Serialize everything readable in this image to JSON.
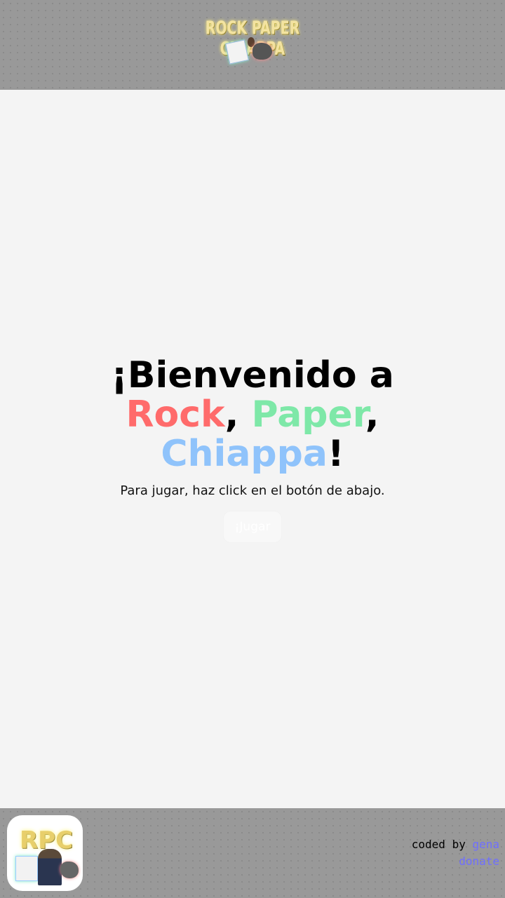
{
  "header": {
    "logo_text": "ROCK PAPER CHIAPPA"
  },
  "main": {
    "title_prefix": "¡Bienvenido a",
    "title_rock": "Rock",
    "title_sep1": ",",
    "title_paper": "Paper",
    "title_sep2": ",",
    "title_chiappa": "Chiappa",
    "title_suffix": "!",
    "instructions": "Para jugar, haz click en el botón de abajo.",
    "play_button": "¡Jugar"
  },
  "footer": {
    "app_icon_text": "RPC",
    "coded_by_label": "coded by",
    "author_link": "gena",
    "donate_link": "donate"
  },
  "colors": {
    "rock": "#ff6b6b",
    "paper": "#7ee8a8",
    "chiappa": "#8fc3fb",
    "link": "#6f6fff"
  }
}
